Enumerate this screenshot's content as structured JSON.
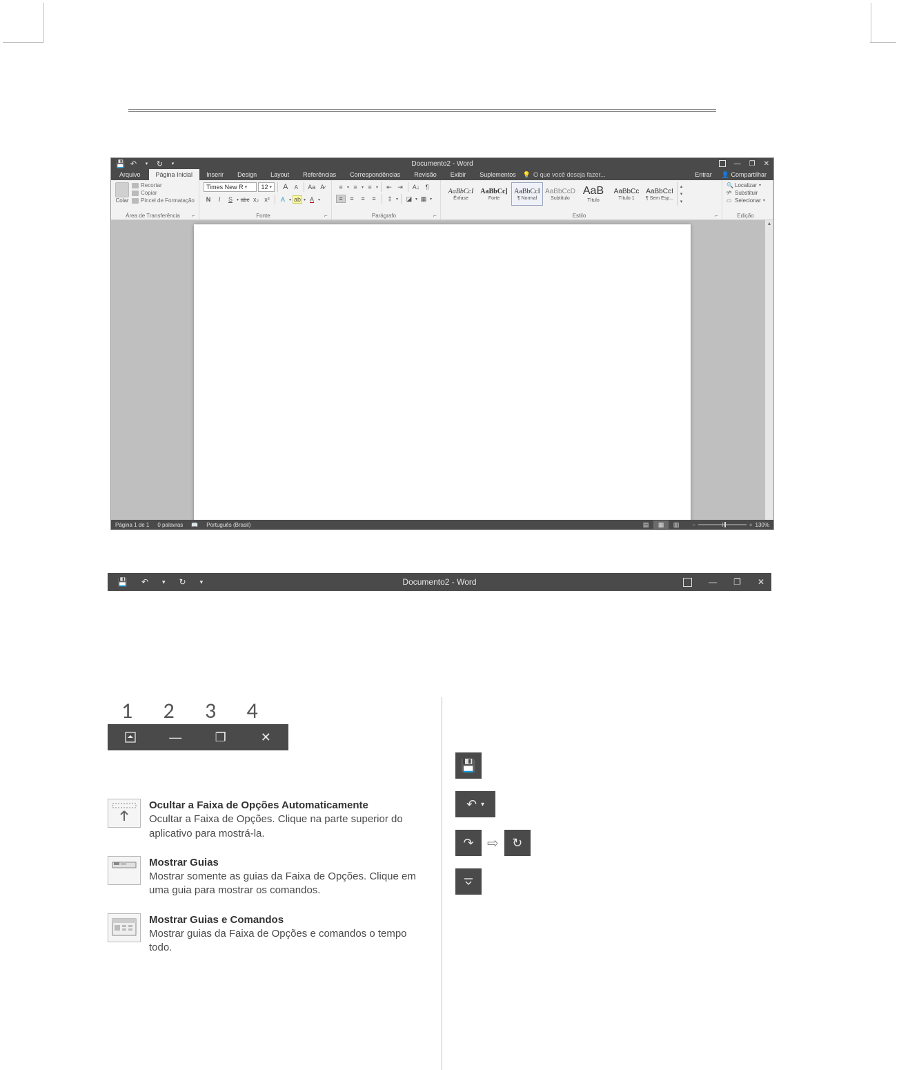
{
  "titlebar": {
    "title": "Documento2 - Word",
    "qat_save": "💾",
    "qat_undo": "↶",
    "qat_redo_refresh": "↻",
    "qat_more": "▾",
    "rd_box": "▣",
    "rd_min": "—",
    "rd_restore": "❐",
    "rd_close": "✕"
  },
  "tabs": {
    "arquivo": "Arquivo",
    "pagina": "Página Inicial",
    "inserir": "Inserir",
    "design": "Design",
    "layout": "Layout",
    "referencias": "Referências",
    "corresp": "Correspondências",
    "revisao": "Revisão",
    "exibir": "Exibir",
    "suplementos": "Suplementos",
    "tellme": "O que você deseja fazer...",
    "entrar": "Entrar",
    "compartilhar": "Compartilhar"
  },
  "clipboard": {
    "paste": "Colar",
    "cut": "Recortar",
    "copy": "Copiar",
    "painter": "Pincel de Formatação",
    "label": "Área de Transferência"
  },
  "font": {
    "name": "Times New R",
    "size": "12",
    "label": "Fonte",
    "grow": "A",
    "shrink": "A",
    "case": "Aa",
    "clear": "⌫",
    "bold": "N",
    "italic": "I",
    "underline": "S",
    "strike": "abc",
    "sub": "x₂",
    "sup": "x²",
    "effects": "A",
    "hilite": "ab",
    "color": "A"
  },
  "para": {
    "label": "Parágrafo"
  },
  "styles": {
    "label": "Estilo",
    "items": [
      {
        "sample": "AaBbCcI",
        "name": "Ênfase"
      },
      {
        "sample": "AaBbCc]",
        "name": "Forte"
      },
      {
        "sample": "AaBbCcI",
        "name": "¶ Normal"
      },
      {
        "sample": "AaBbCcD",
        "name": "Subtítulo"
      },
      {
        "sample": "AaB",
        "name": "Título"
      },
      {
        "sample": "AaBbCc",
        "name": "Título 1"
      },
      {
        "sample": "AaBbCcI",
        "name": "¶ Sem Esp..."
      }
    ]
  },
  "editing": {
    "find": "Localizar",
    "replace": "Substituir",
    "select": "Selecionar",
    "label": "Edição"
  },
  "status": {
    "page": "Página 1 de 1",
    "words": "0 palavras",
    "lang": "Português (Brasil)",
    "zoom": "130%"
  },
  "bar2": {
    "title": "Documento2 - Word"
  },
  "numbers": {
    "n1": "1",
    "n2": "2",
    "n3": "3",
    "n4": "4"
  },
  "strip": {
    "ribbon_icon": "▣",
    "min": "—",
    "restore": "❐",
    "close": "✕"
  },
  "ribbonOptions": {
    "opt1_hdr": "Ocultar a Faixa de Opções Automaticamente",
    "opt1_body": "Ocultar a Faixa de Opções. Clique na parte superior do aplicativo para mostrá-la.",
    "opt2_hdr": "Mostrar Guias",
    "opt2_body": "Mostrar somente as guias da Faixa de Opções. Clique em uma guia para mostrar os comandos.",
    "opt3_hdr": "Mostrar Guias e Comandos",
    "opt3_body": "Mostrar guias da Faixa de Opções e comandos o tempo todo."
  },
  "rightTiles": {
    "save": "💾",
    "undo": "↶",
    "undo_caret": "▾",
    "redo": "↷",
    "refresh": "↻",
    "more": "▾"
  }
}
